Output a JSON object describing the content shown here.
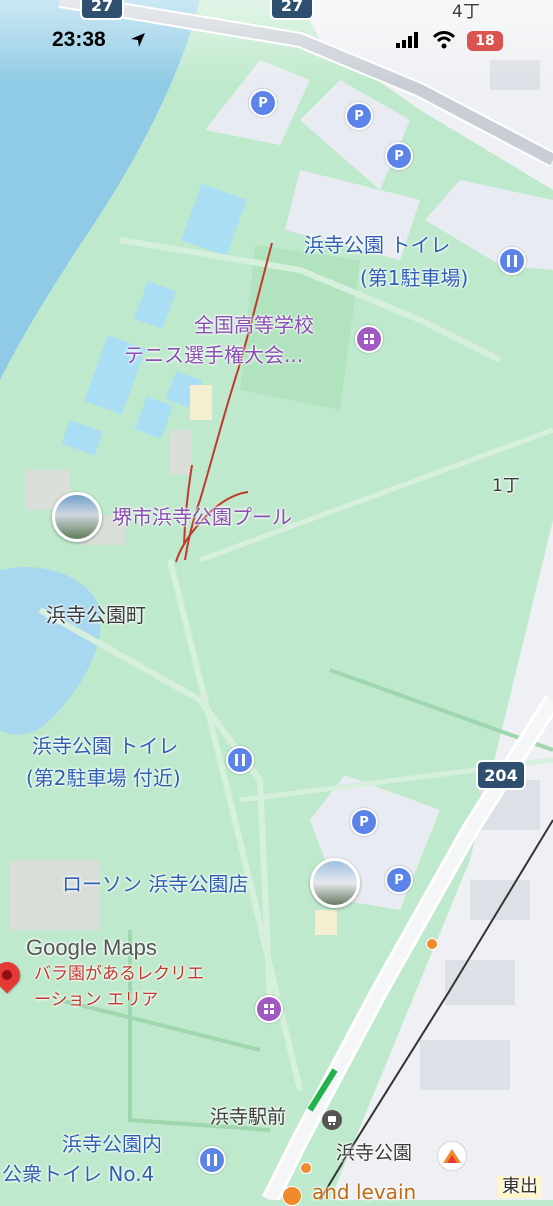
{
  "status_bar": {
    "time": "23:38",
    "battery": "18"
  },
  "district_labels": {
    "chome4": "4丁",
    "chome1": "1丁",
    "town": "浜寺公園町",
    "east": "東出"
  },
  "pois": {
    "toilet1_line1": "浜寺公園 トイレ",
    "toilet1_line2": "(第1駐車場)",
    "tennis_line1": "全国高等学校",
    "tennis_line2": "テニス選手権大会...",
    "pool": "堺市浜寺公園プール",
    "toilet2_line1": "浜寺公園 トイレ",
    "toilet2_line2": "(第2駐車場 付近)",
    "lawson": "ローソン 浜寺公園店",
    "rose_line1": "バラ園があるレクリエ",
    "rose_line2": "ーション エリア",
    "station_front": "浜寺駅前",
    "station": "浜寺公園",
    "toilet4_line1": "浜寺公園内",
    "toilet4_line2": "公衆トイレ No.4",
    "and_levain": "and levain"
  },
  "roads": {
    "route27a": "27",
    "route27b": "27",
    "route204": "204"
  },
  "attribution": "Google Maps",
  "icons": {
    "parking": "P",
    "location_arrow": "location-arrow-icon",
    "toilet": "toilet-icon",
    "event": "event-icon",
    "train": "train-icon",
    "food": "food-icon"
  },
  "colors": {
    "park": "#bfe9cc",
    "water": "#8fcbe6",
    "parking_lot": "#e8ecf2",
    "annotation": "#c0392b"
  }
}
